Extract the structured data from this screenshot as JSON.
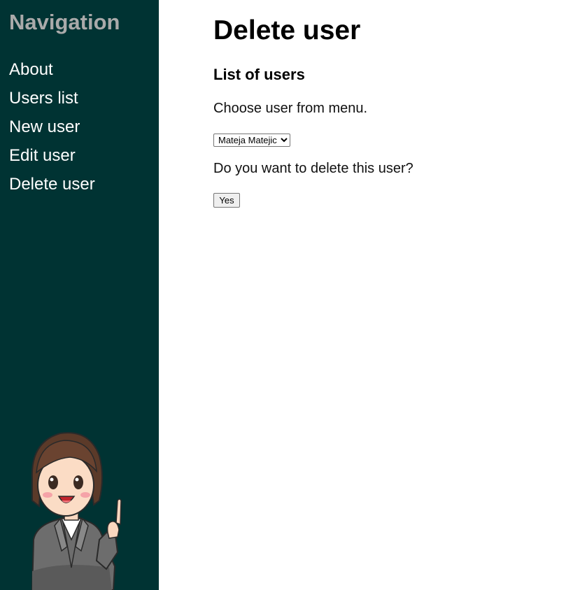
{
  "sidebar": {
    "title": "Navigation",
    "items": [
      {
        "label": "About"
      },
      {
        "label": "Users list"
      },
      {
        "label": "New user"
      },
      {
        "label": "Edit user"
      },
      {
        "label": "Delete user"
      }
    ],
    "mascot_icon": "mascot-woman-pointing-icon"
  },
  "main": {
    "title": "Delete user",
    "section_title": "List of users",
    "instruction": "Choose user from menu.",
    "user_select": {
      "selected": "Mateja Matejic"
    },
    "question": "Do you want to delete this user?",
    "confirm_label": "Yes"
  },
  "colors": {
    "sidebar_bg": "#003333",
    "nav_title": "#aaaaaa",
    "nav_link": "#ffffff"
  }
}
